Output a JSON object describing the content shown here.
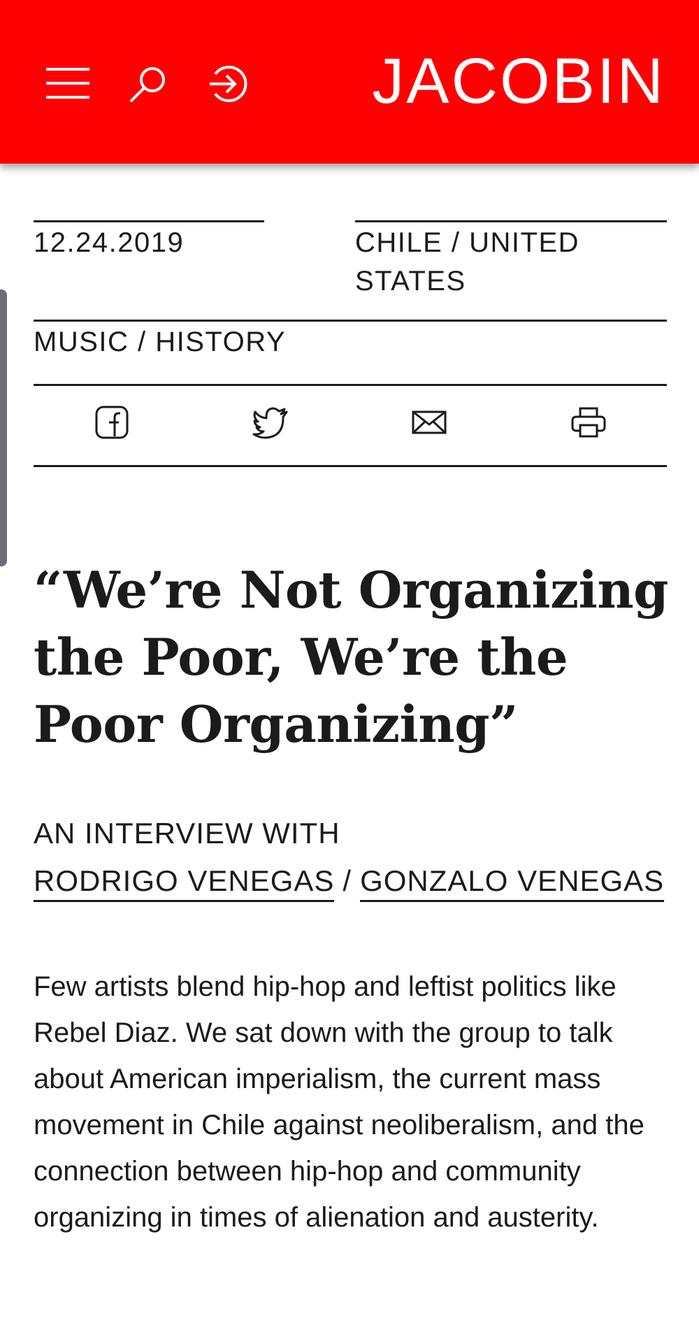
{
  "header": {
    "logo": "JACOBIN",
    "brand_color": "#ff0000",
    "icons": [
      "menu-icon",
      "search-icon",
      "login-icon"
    ]
  },
  "meta": {
    "date": "12.24.2019",
    "location": "CHILE / UNITED STATES",
    "topics": "MUSIC / HISTORY"
  },
  "share": {
    "icons": [
      "facebook-icon",
      "twitter-icon",
      "email-icon",
      "print-icon"
    ]
  },
  "article": {
    "title": "“We’re Not Organizing the Poor, We’re the Poor Organizing”",
    "byline_prefix": "AN INTERVIEW WITH",
    "authors": [
      "RODRIGO VENEGAS",
      "GONZALO VENEGAS"
    ],
    "author_separator": "/",
    "dek": "Few artists blend hip-hop and leftist politics like Rebel Diaz. We sat down with the group to talk about American imperialism, the current mass movement in Chile against neoliberalism, and the connection between hip-hop and community organizing in times of alienation and austerity."
  }
}
